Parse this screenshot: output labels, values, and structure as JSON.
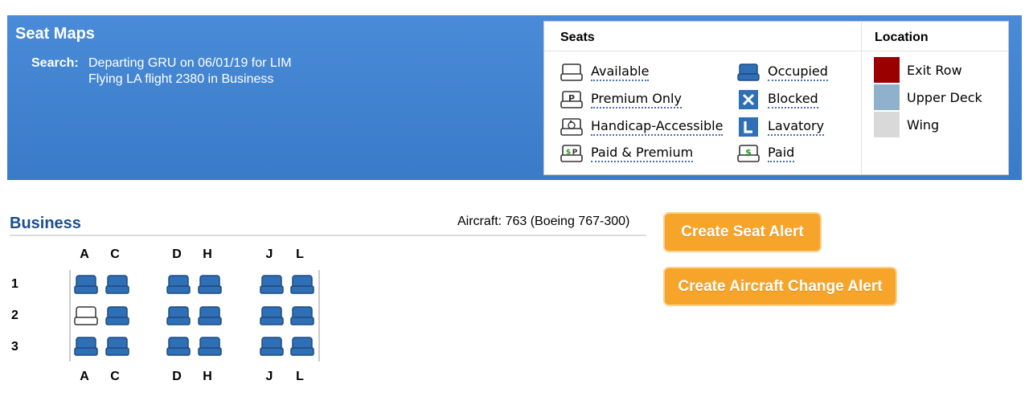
{
  "header": {
    "title": "Seat Maps",
    "search_label": "Search:",
    "search_line1": "Departing GRU on 06/01/19 for LIM",
    "search_line2": "Flying LA flight 2380 in Business"
  },
  "legend": {
    "seats_heading": "Seats",
    "location_heading": "Location",
    "seat_types": [
      {
        "label": "Available",
        "icon": "available-seat-icon"
      },
      {
        "label": "Premium Only",
        "icon": "premium-seat-icon"
      },
      {
        "label": "Handicap-Accessible",
        "icon": "handicap-seat-icon"
      },
      {
        "label": "Paid & Premium",
        "icon": "paid-premium-seat-icon"
      },
      {
        "label": "Occupied",
        "icon": "occupied-seat-icon"
      },
      {
        "label": "Blocked",
        "icon": "blocked-icon"
      },
      {
        "label": "Lavatory",
        "icon": "lavatory-icon"
      },
      {
        "label": "Paid",
        "icon": "paid-seat-icon"
      }
    ],
    "locations": [
      {
        "label": "Exit Row",
        "color": "#9b0000"
      },
      {
        "label": "Upper Deck",
        "color": "#8fb1cc"
      },
      {
        "label": "Wing",
        "color": "#d9d9d9"
      }
    ]
  },
  "section": {
    "title": "Business",
    "aircraft": "Aircraft: 763 (Boeing 767-300)"
  },
  "buttons": {
    "seat_alert": "Create Seat Alert",
    "aircraft_change_alert": "Create Aircraft Change Alert"
  },
  "seatmap": {
    "columns": [
      "A",
      "C",
      "D",
      "H",
      "J",
      "L"
    ],
    "rows": [
      {
        "number": "1",
        "seats": [
          "occupied",
          "occupied",
          "occupied",
          "occupied",
          "occupied",
          "occupied"
        ]
      },
      {
        "number": "2",
        "seats": [
          "available",
          "occupied",
          "occupied",
          "occupied",
          "occupied",
          "occupied"
        ]
      },
      {
        "number": "3",
        "seats": [
          "occupied",
          "occupied",
          "occupied",
          "occupied",
          "occupied",
          "occupied"
        ]
      }
    ]
  },
  "colors": {
    "banner": "#3f80cf",
    "occupied_seat": "#2f6fb6",
    "button": "#f7a42a",
    "section_title": "#1a4f8f"
  }
}
